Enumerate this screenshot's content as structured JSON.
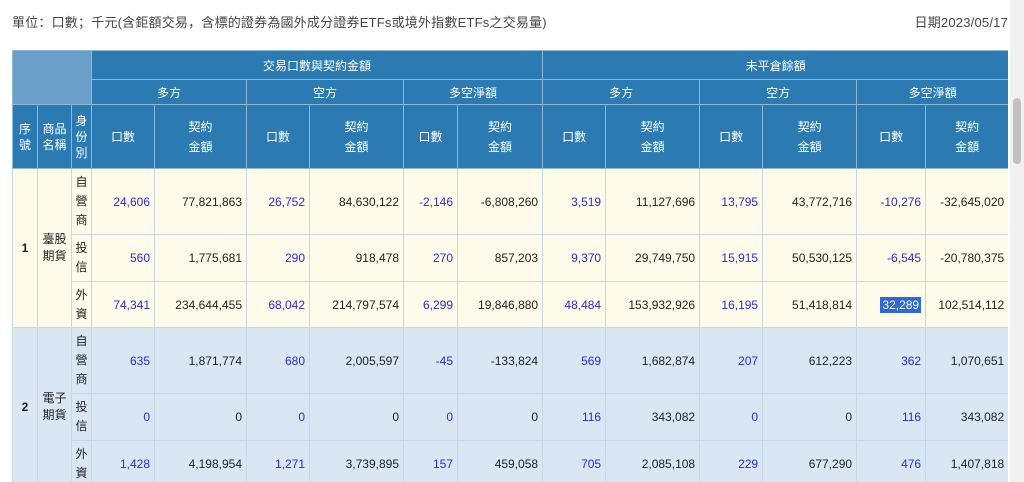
{
  "header": {
    "unit_text": "單位：口數；千元(含鉅額交易，含標的證券為國外成分證券ETFs或境外指數ETFs之交易量)",
    "date_text": "日期2023/05/17"
  },
  "table": {
    "group_headers": [
      "交易口數與契約金額",
      "未平倉餘額"
    ],
    "sub_headers": [
      "多方",
      "空方",
      "多空淨額",
      "多方",
      "空方",
      "多空淨額"
    ],
    "fixed_headers": {
      "seq": "序\n號",
      "product": "商品\n名稱",
      "identity": "身\n份\n別"
    },
    "qty_header": "口數",
    "amount_header": "契約\n金額",
    "groups": [
      {
        "seq": "1",
        "product": "臺股\n期貨",
        "rows": [
          {
            "identity": "自\n營\n商",
            "values": [
              "24,606",
              "77,821,863",
              "26,752",
              "84,630,122",
              "-2,146",
              "-6,808,260",
              "3,519",
              "11,127,696",
              "13,795",
              "43,772,716",
              "-10,276",
              "-32,645,020"
            ]
          },
          {
            "identity": "投\n信",
            "values": [
              "560",
              "1,775,681",
              "290",
              "918,478",
              "270",
              "857,203",
              "9,370",
              "29,749,750",
              "15,915",
              "50,530,125",
              "-6,545",
              "-20,780,375"
            ]
          },
          {
            "identity": "外\n資",
            "values": [
              "74,341",
              "234,644,455",
              "68,042",
              "214,797,574",
              "6,299",
              "19,846,880",
              "48,484",
              "153,932,926",
              "16,195",
              "51,418,814",
              "32,289",
              "102,514,112"
            ]
          }
        ]
      },
      {
        "seq": "2",
        "product": "電子\n期貨",
        "rows": [
          {
            "identity": "自\n營\n商",
            "values": [
              "635",
              "1,871,774",
              "680",
              "2,005,597",
              "-45",
              "-133,824",
              "569",
              "1,682,874",
              "207",
              "612,223",
              "362",
              "1,070,651"
            ]
          },
          {
            "identity": "投\n信",
            "values": [
              "0",
              "0",
              "0",
              "0",
              "0",
              "0",
              "116",
              "343,082",
              "0",
              "0",
              "116",
              "343,082"
            ]
          },
          {
            "identity": "外\n資",
            "values": [
              "1,428",
              "4,198,954",
              "1,271",
              "3,739,895",
              "157",
              "459,058",
              "705",
              "2,085,108",
              "229",
              "677,290",
              "476",
              "1,407,818"
            ]
          }
        ]
      }
    ]
  },
  "selection": {
    "group": 0,
    "row": 2,
    "col": 10
  },
  "colors": {
    "header_bg": "#2b7bb2",
    "corner_bg": "#6a9fca",
    "group1_bg": "#fffbea",
    "group2_bg": "#d9e7f4",
    "qty_text": "#2b2bd6",
    "selection": "#3068d6"
  }
}
